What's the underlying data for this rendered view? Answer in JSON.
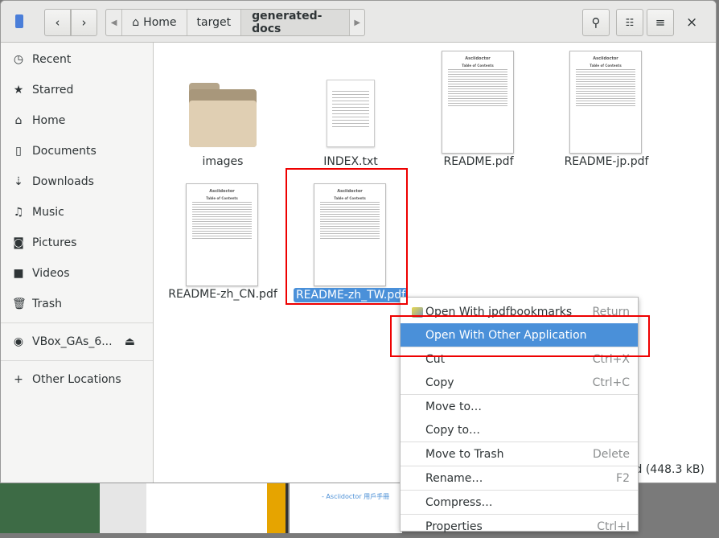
{
  "toolbar": {
    "breadcrumbs": [
      "Home",
      "target",
      "generated-docs"
    ],
    "back": "‹",
    "forward": "›",
    "close": "×"
  },
  "sidebar": {
    "items": [
      {
        "label": "Recent",
        "icon": "clock-icon",
        "glyph": "◷"
      },
      {
        "label": "Starred",
        "icon": "star-icon",
        "glyph": "★"
      },
      {
        "label": "Home",
        "icon": "home-icon",
        "glyph": "⌂"
      },
      {
        "label": "Documents",
        "icon": "document-icon",
        "glyph": "▯"
      },
      {
        "label": "Downloads",
        "icon": "download-icon",
        "glyph": "⇣"
      },
      {
        "label": "Music",
        "icon": "music-icon",
        "glyph": "♫"
      },
      {
        "label": "Pictures",
        "icon": "camera-icon",
        "glyph": "◙"
      },
      {
        "label": "Videos",
        "icon": "video-icon",
        "glyph": "■"
      },
      {
        "label": "Trash",
        "icon": "trash-icon",
        "glyph": "🗑"
      }
    ],
    "device": {
      "label": "VBox_GAs_6...",
      "eject": "⏏"
    },
    "other": {
      "label": "Other Locations",
      "glyph": "+"
    }
  },
  "files": [
    {
      "name": "images",
      "type": "folder"
    },
    {
      "name": "INDEX.txt",
      "type": "text"
    },
    {
      "name": "README.pdf",
      "type": "pdf",
      "title": "Asciidoctor",
      "toc": "Table of Contents"
    },
    {
      "name": "README-jp.pdf",
      "type": "pdf",
      "title": "Asciidoctor",
      "toc": "Table of Contents"
    },
    {
      "name": "README-zh_CN.pdf",
      "type": "pdf",
      "title": "Asciidoctor",
      "toc": "Table of Contents"
    },
    {
      "name": "README-zh_TW.pdf",
      "type": "pdf",
      "title": "Asciidoctor",
      "toc": "Table of Contents",
      "selected": true
    }
  ],
  "status": "ed  (448.3 kB)",
  "context_menu": [
    {
      "label": "Open With jpdfbookmarks",
      "shortcut": "Return"
    },
    {
      "label": "Open With Other Application",
      "shortcut": "",
      "highlighted": true
    },
    {
      "label": "Cut",
      "shortcut": "Ctrl+X"
    },
    {
      "label": "Copy",
      "shortcut": "Ctrl+C"
    },
    {
      "label": "Move to…",
      "shortcut": ""
    },
    {
      "label": "Copy to…",
      "shortcut": ""
    },
    {
      "label": "Move to Trash",
      "shortcut": "Delete"
    },
    {
      "label": "Rename…",
      "shortcut": "F2"
    },
    {
      "label": "Compress…",
      "shortcut": ""
    },
    {
      "label": "Properties",
      "shortcut": "Ctrl+I"
    }
  ],
  "background": {
    "doc_link": "- Asciidoctor 用戶手冊"
  },
  "colors": {
    "accent": "#4a90d9",
    "highlight_box": "#ee0000"
  }
}
